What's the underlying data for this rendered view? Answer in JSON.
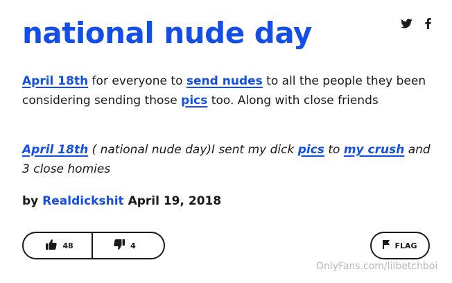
{
  "entry": {
    "title": "national nude day",
    "meaning": {
      "link_date": "April 18th",
      "text_1": " for everyone to ",
      "link_send": "send nudes",
      "text_2": " to all the people they been considering sending those ",
      "link_pics": "pics",
      "text_3": " too. Along with close friends"
    },
    "example": {
      "link_date": "April 18th",
      "text_1": " ( national nude day)I sent my dick ",
      "link_pics": "pics",
      "text_2": " to ",
      "link_crush": "my crush",
      "text_3": " and 3 close homies"
    },
    "byline": {
      "prefix": "by ",
      "author": "Realdickshit",
      "date": " April 19, 2018"
    }
  },
  "share": {
    "icons": [
      "twitter-icon",
      "facebook-icon"
    ]
  },
  "votes": {
    "up_count": "48",
    "down_count": "4"
  },
  "flag": {
    "label": "FLAG"
  },
  "watermark": "OnlyFans.com/lilbetchboi",
  "colors": {
    "accent": "#134fe6",
    "text": "#1a1a1a",
    "watermark": "#b9b9b9"
  }
}
